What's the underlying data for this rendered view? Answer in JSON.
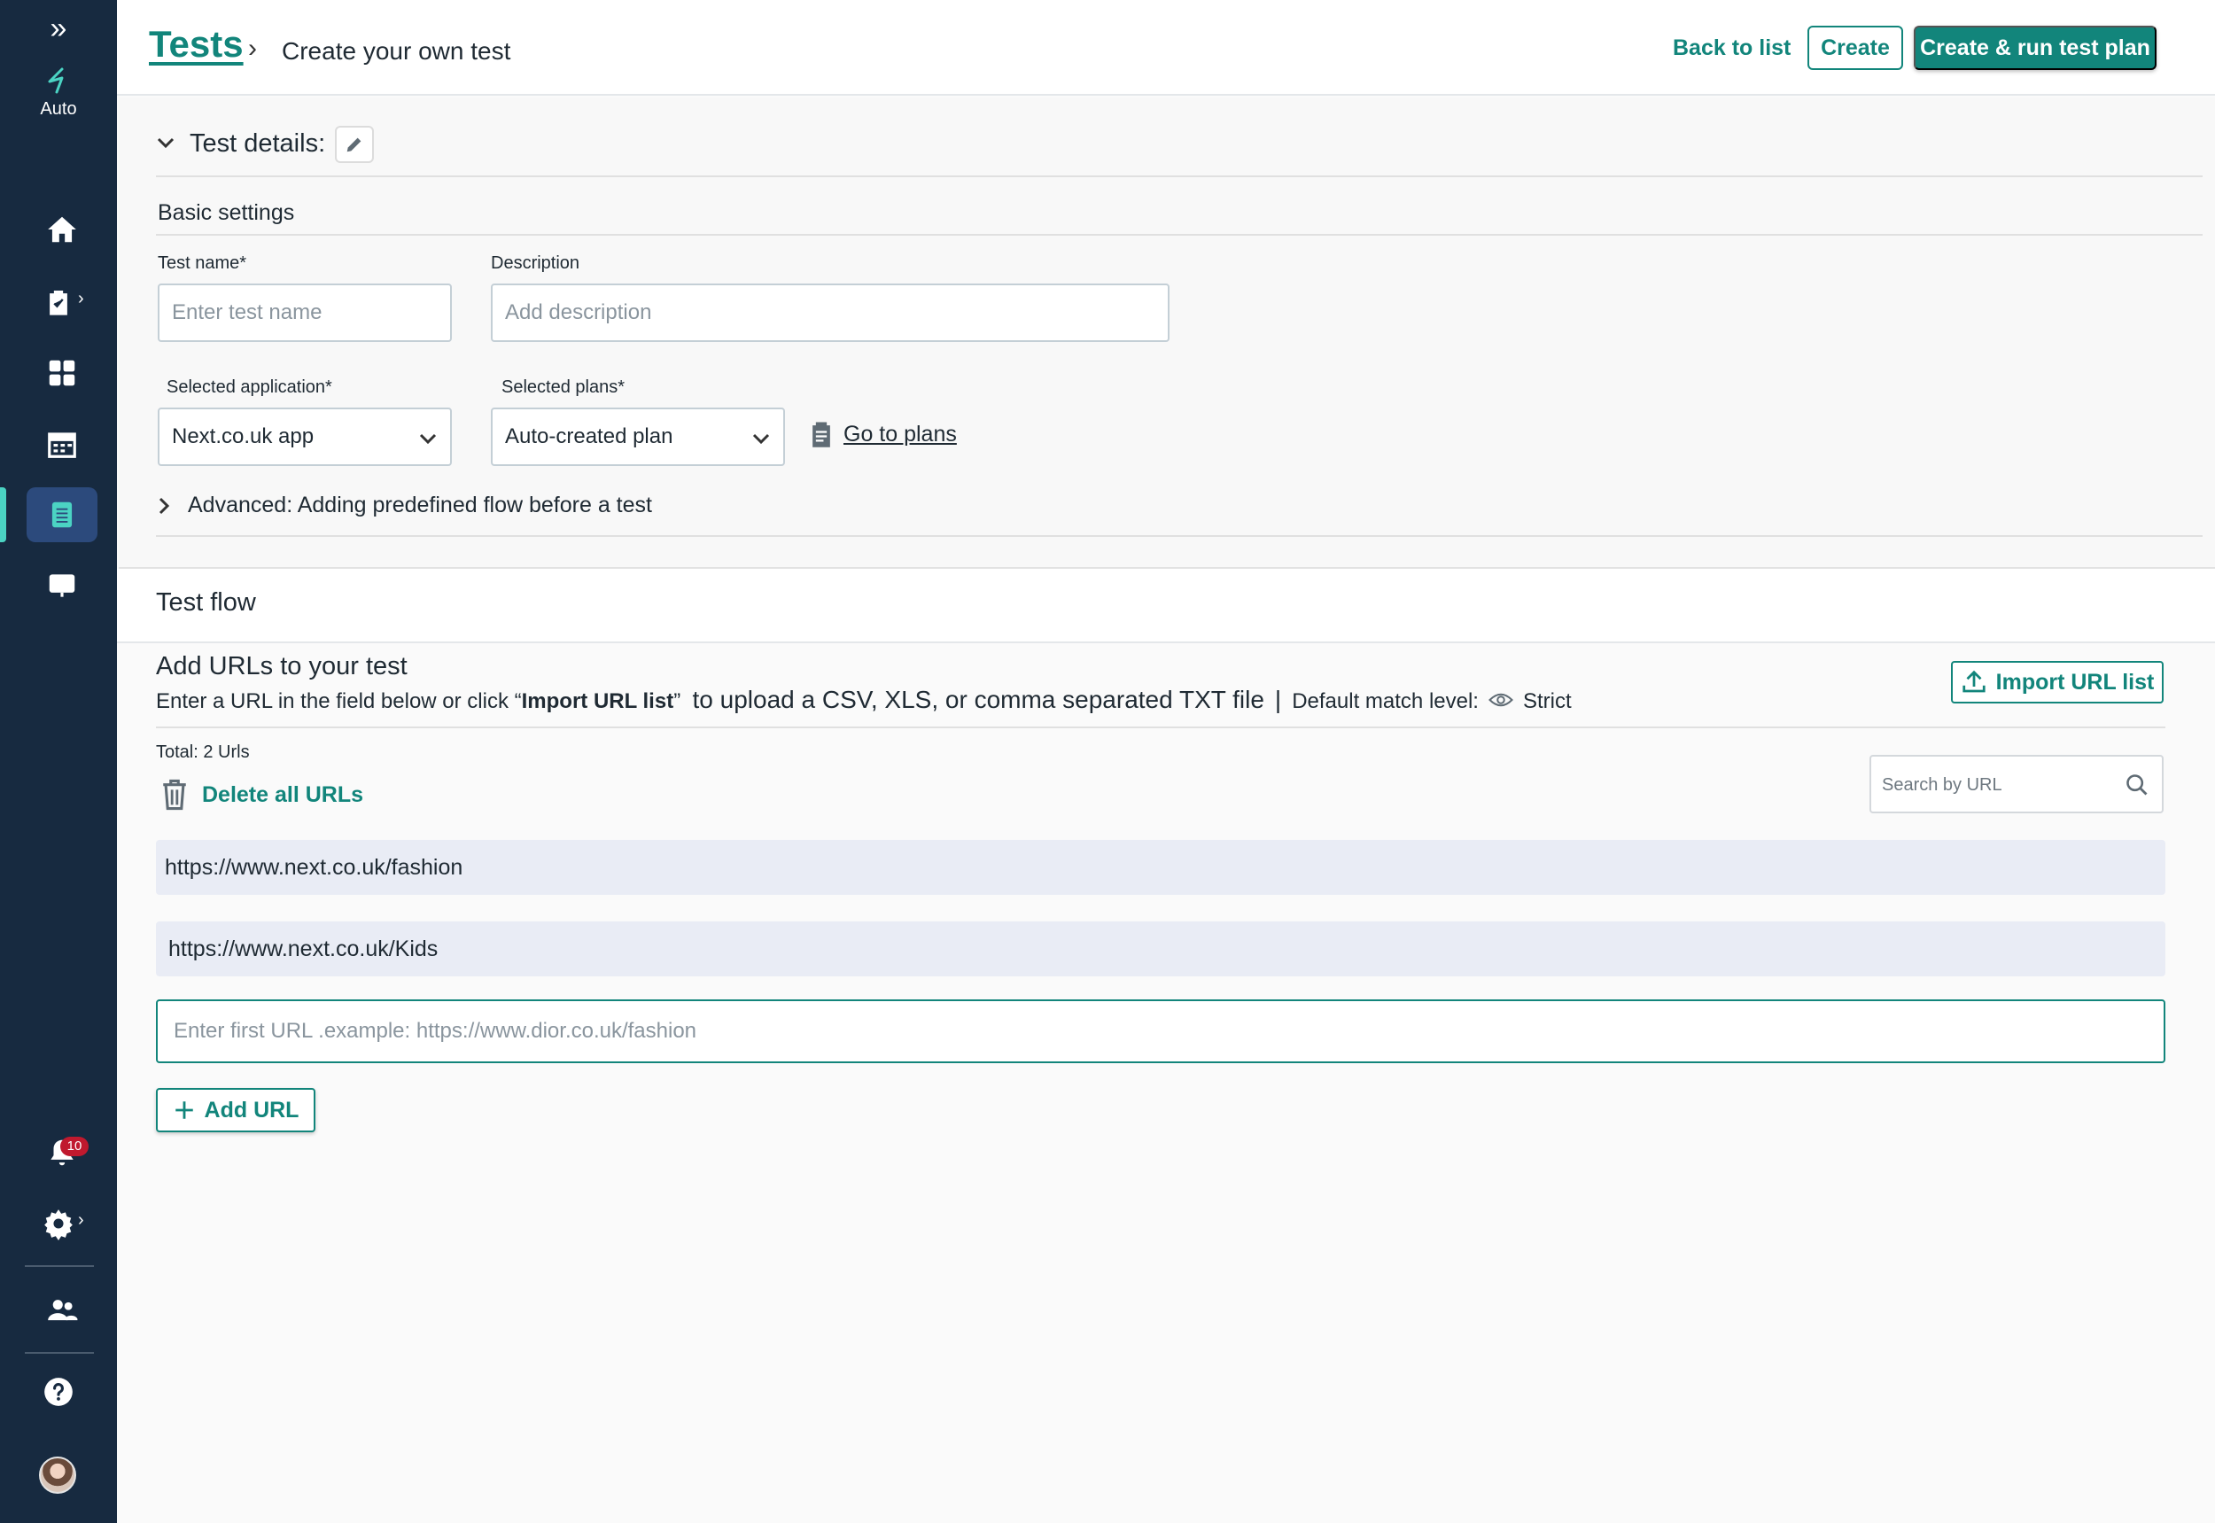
{
  "sidebar": {
    "logo_label": "Auto",
    "notification_count": "10"
  },
  "header": {
    "breadcrumb_root": "Tests",
    "breadcrumb_page": "Create your own test",
    "back_label": "Back to list",
    "create_label": "Create",
    "create_run_label": "Create & run test plan"
  },
  "details": {
    "title": "Test details:",
    "basic_settings": "Basic settings",
    "test_name_label": "Test name*",
    "test_name_placeholder": "Enter test name",
    "description_label": "Description",
    "description_placeholder": "Add description",
    "app_label": "Selected application*",
    "app_value": "Next.co.uk app",
    "plans_label": "Selected plans*",
    "plans_value": "Auto-created plan",
    "goto_plans": "Go to plans",
    "advanced": "Advanced: Adding predefined flow before a test"
  },
  "flow": {
    "title": "Test flow",
    "add_title": "Add  URLs to your test",
    "hint_part1": "Enter a URL in the field below  or click “",
    "hint_bold": "Import URL list",
    "hint_part2": "”  ",
    "hint_part3": "to upload a CSV, XLS, or comma separated TXT file",
    "hint_sep": "|",
    "match_label": "Default match level:",
    "match_value": "Strict",
    "import_label": "Import URL list",
    "total": "Total: 2 Urls",
    "delete_all": "Delete all URLs",
    "search_placeholder": "Search by URL",
    "urls": [
      "https://www.next.co.uk/fashion",
      "https://www.next.co.uk/Kids"
    ],
    "url_placeholder": "Enter first URL .example: https://www.dior.co.uk/fashion",
    "add_url": "Add URL"
  },
  "colors": {
    "accent": "#12857b",
    "sidebar": "#172a40",
    "sidebar_active": "#2c4a7c",
    "badge": "#c0192e"
  }
}
